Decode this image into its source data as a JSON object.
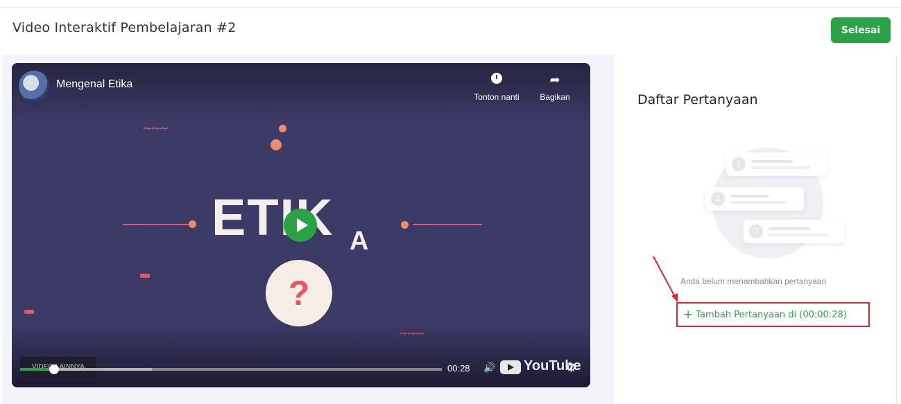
{
  "header": {
    "title": "Video Interaktif Pembelajaran #2",
    "done_label": "Selesai"
  },
  "player": {
    "video_title": "Mengenal Etika",
    "watch_later_label": "Tonton nanti",
    "share_label": "Bagikan",
    "headline_main": "ETIK",
    "headline_tail": "A",
    "question_mark": "?",
    "more_videos_label": "VIDEO LAINNYA",
    "current_time": "00:28",
    "progress_fraction": 0.08,
    "logo_word": "YouTube"
  },
  "sidebar": {
    "title": "Daftar Pertanyaan",
    "empty_message": "Anda belum menambahkan pertanyaan",
    "add_button_label": "Tambah Pertanyaan di (00:00:28)",
    "illustration_numbers": [
      "1",
      "2",
      "3"
    ]
  },
  "colors": {
    "accent": "#2aa245",
    "highlight": "#e2232f"
  },
  "icons": {
    "avatar": "channel-avatar-icon",
    "watch_later": "clock-icon",
    "share": "share-arrow-icon",
    "play": "play-icon",
    "volume": "volume-icon",
    "settings": "gear-icon",
    "add": "plus-icon"
  }
}
